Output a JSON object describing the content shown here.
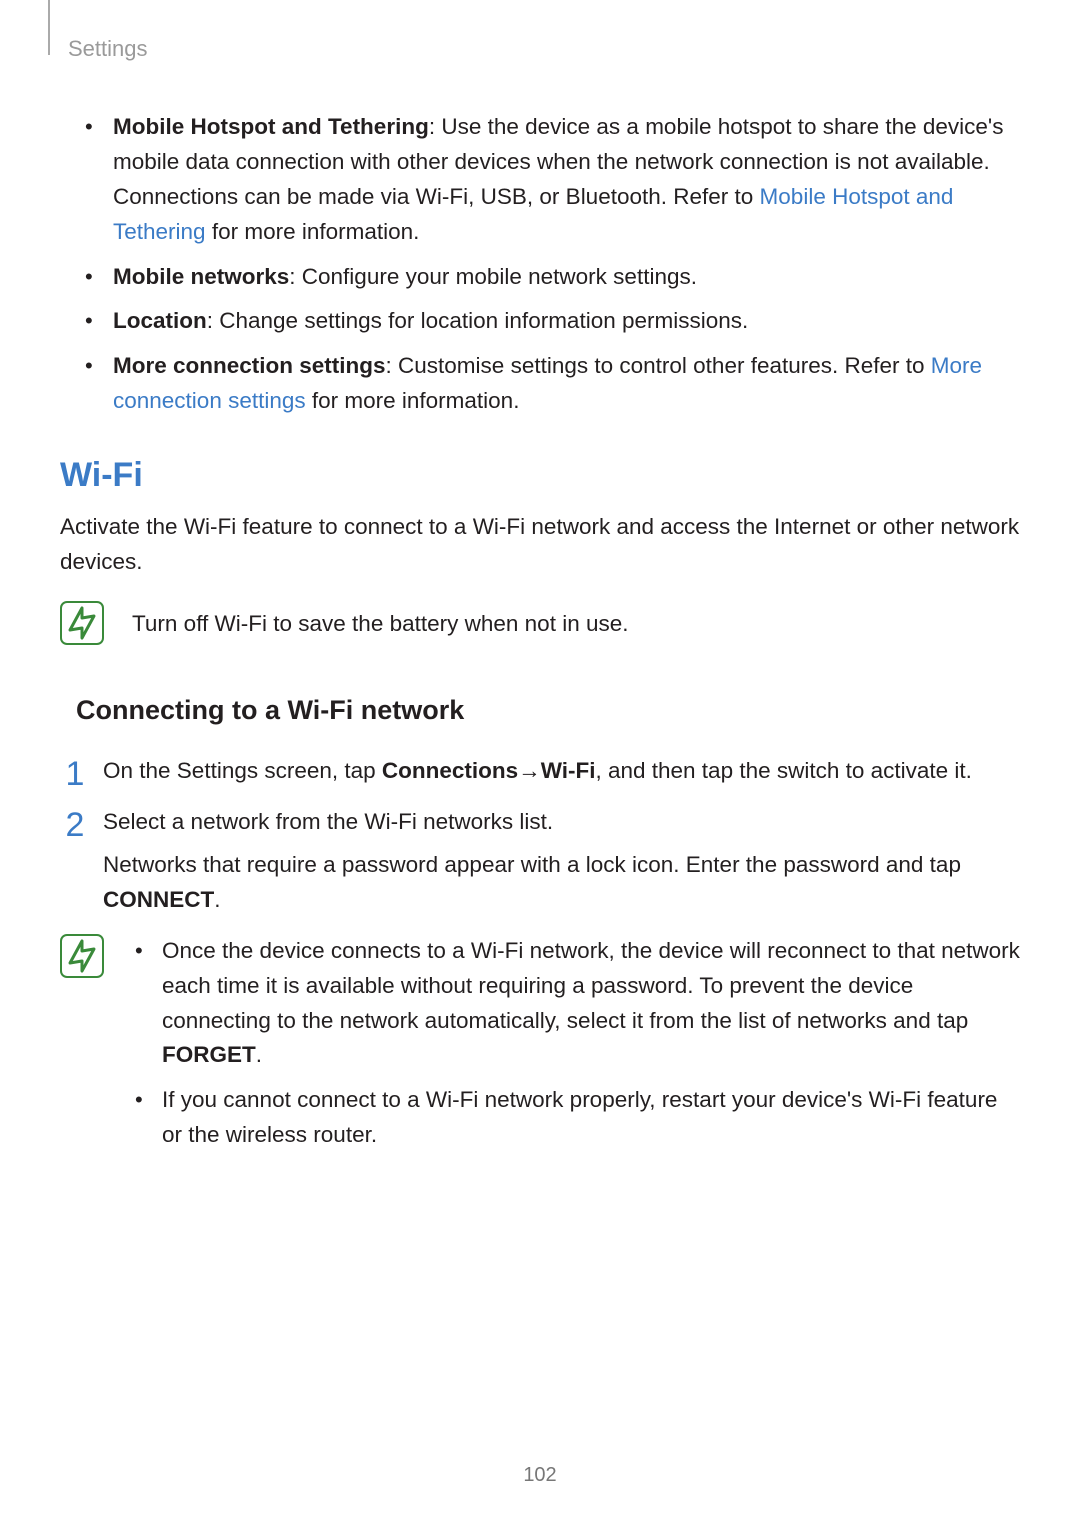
{
  "header": {
    "section_title": "Settings"
  },
  "bullets": [
    {
      "bold": "Mobile Hotspot and Tethering",
      "text_before_link": ": Use the device as a mobile hotspot to share the device's mobile data connection with other devices when the network connection is not available. Connections can be made via Wi-Fi, USB, or Bluetooth. Refer to ",
      "link": "Mobile Hotspot and Tethering",
      "text_after_link": " for more information."
    },
    {
      "bold": "Mobile networks",
      "text_before_link": ": Configure your mobile network settings.",
      "link": "",
      "text_after_link": ""
    },
    {
      "bold": "Location",
      "text_before_link": ": Change settings for location information permissions.",
      "link": "",
      "text_after_link": ""
    },
    {
      "bold": "More connection settings",
      "text_before_link": ": Customise settings to control other features. Refer to ",
      "link": "More connection settings",
      "text_after_link": " for more information."
    }
  ],
  "wifi": {
    "heading": "Wi-Fi",
    "intro": "Activate the Wi-Fi feature to connect to a Wi-Fi network and access the Internet or other network devices.",
    "tip1": "Turn off Wi-Fi to save the battery when not in use.",
    "subheading": "Connecting to a Wi-Fi network",
    "step1": {
      "pre": "On the Settings screen, tap ",
      "b1": "Connections",
      "arrow": " → ",
      "b2": "Wi-Fi",
      "post": ", and then tap the switch to activate it."
    },
    "step2": {
      "line1": "Select a network from the Wi-Fi networks list.",
      "line2_pre": "Networks that require a password appear with a lock icon. Enter the password and tap ",
      "line2_bold": "CONNECT",
      "line2_post": "."
    },
    "tip2": {
      "items": [
        {
          "pre": "Once the device connects to a Wi-Fi network, the device will reconnect to that network each time it is available without requiring a password. To prevent the device connecting to the network automatically, select it from the list of networks and tap ",
          "bold": "FORGET",
          "post": "."
        },
        {
          "pre": "If you cannot connect to a Wi-Fi network properly, restart your device's Wi-Fi feature or the wireless router.",
          "bold": "",
          "post": ""
        }
      ]
    }
  },
  "page_number": "102"
}
